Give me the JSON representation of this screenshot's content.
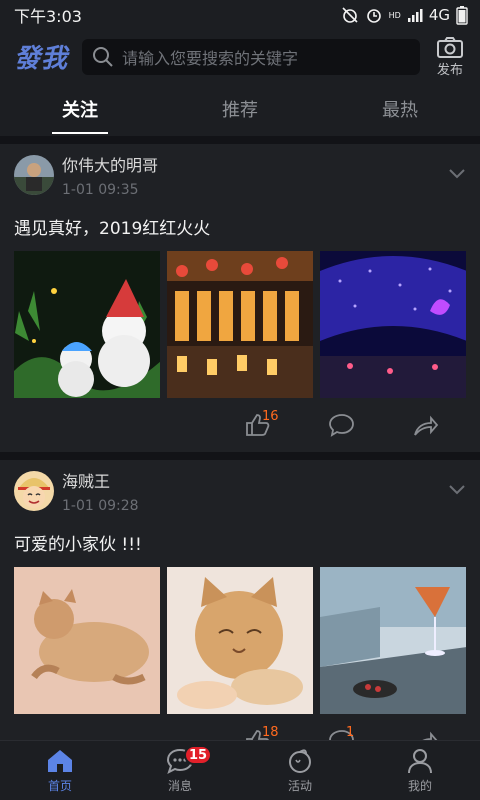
{
  "status": {
    "time": "下午3:03",
    "network": "4G",
    "hd": "HD",
    "progress": 0.49
  },
  "header": {
    "logo": "發我",
    "search_placeholder": "请输入您要搜索的关键字",
    "publish_label": "发布"
  },
  "tabs": [
    {
      "label": "关注",
      "active": true
    },
    {
      "label": "推荐",
      "active": false
    },
    {
      "label": "最热",
      "active": false
    }
  ],
  "posts": [
    {
      "user": "你伟大的明哥",
      "time": "1-01 09:35",
      "text": "遇见真好，2019红红火火",
      "likes": "16",
      "comments": ""
    },
    {
      "user": "海贼王",
      "time": "1-01 09:28",
      "text": "可爱的小家伙 !!!",
      "likes": "18",
      "comments": "1"
    }
  ],
  "bottom_nav": [
    {
      "label": "首页",
      "active": true
    },
    {
      "label": "消息",
      "active": false,
      "badge": "15"
    },
    {
      "label": "活动",
      "active": false
    },
    {
      "label": "我的",
      "active": false
    }
  ],
  "colors": {
    "accent": "#5c84e6",
    "count": "#ff6a1f",
    "badge": "#e2202a",
    "background": "#121317"
  }
}
